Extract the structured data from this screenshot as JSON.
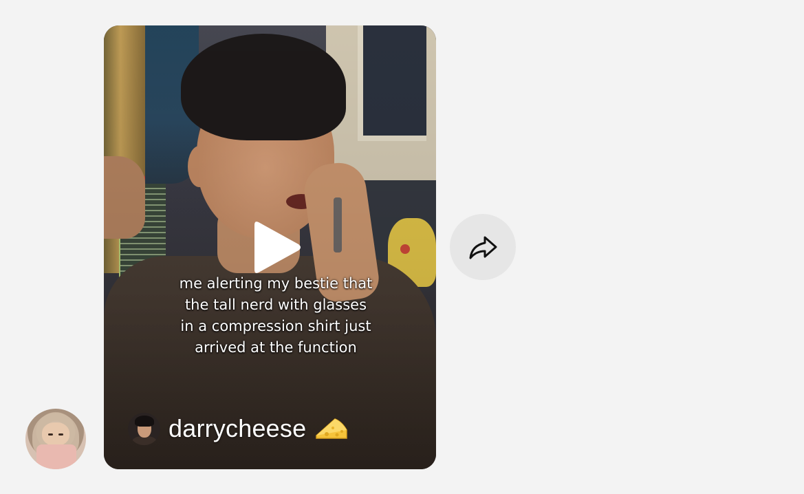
{
  "message": {
    "sender_avatar_icon": "user-avatar",
    "video": {
      "caption_lines": [
        "me alerting my bestie that",
        "the tall nerd with glasses",
        "in a compression shirt just",
        "arrived at the function"
      ],
      "author": {
        "username": "darrycheese",
        "emoji_icon": "cheese-icon"
      },
      "play_icon": "play-icon"
    },
    "share_icon": "share-arrow-icon"
  },
  "colors": {
    "background": "#f3f3f3",
    "share_button_bg": "#e6e6e6",
    "text_on_video": "#ffffff",
    "cheese": "#f5c33b"
  }
}
